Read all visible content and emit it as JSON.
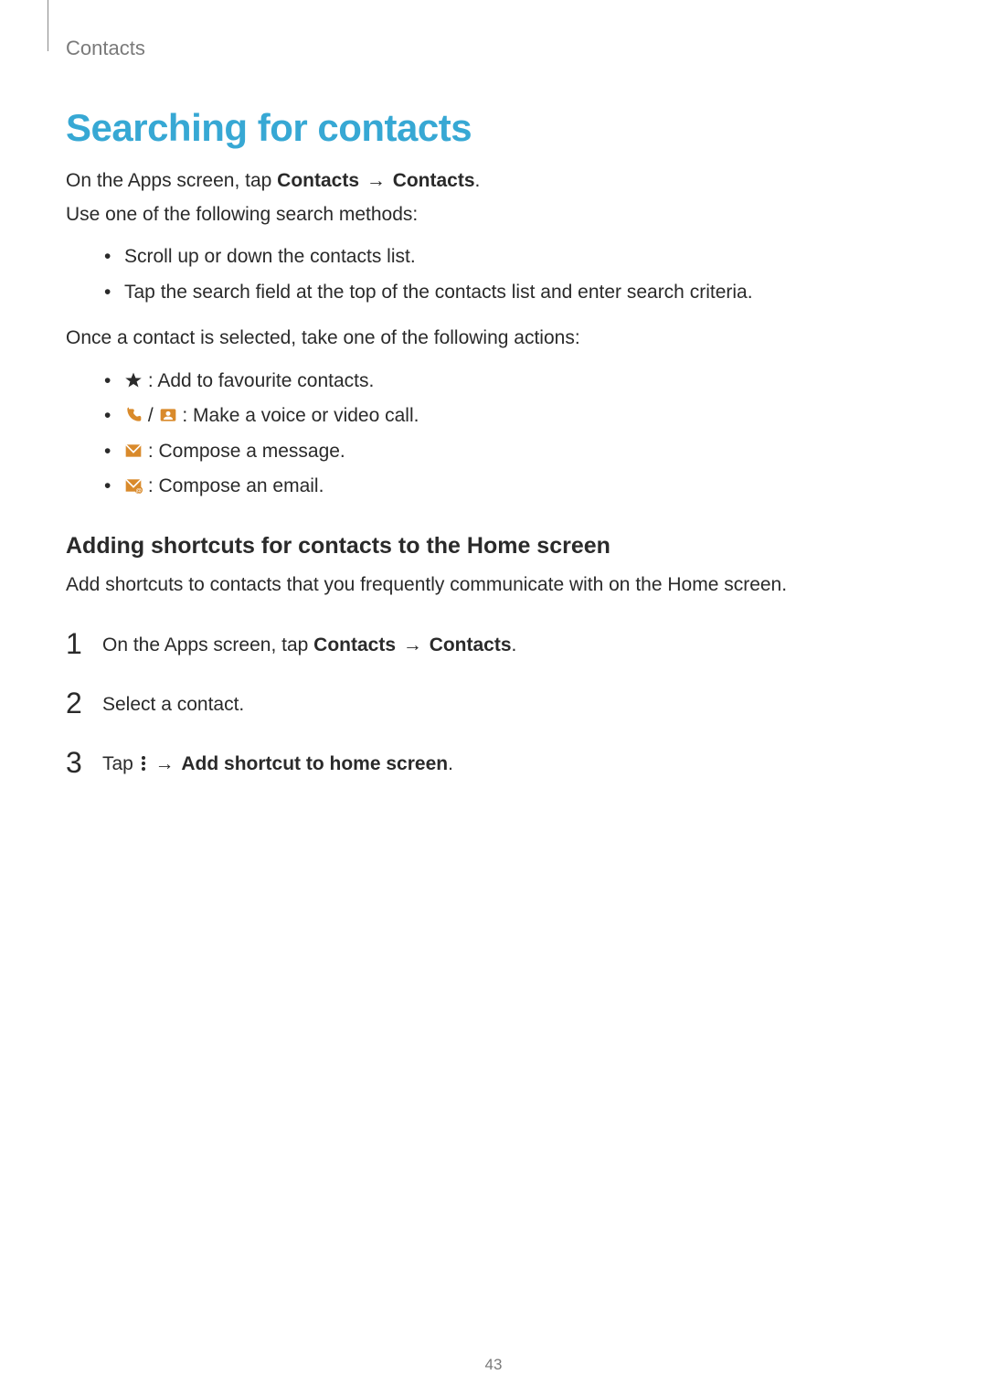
{
  "breadcrumb": "Contacts",
  "title": "Searching for contacts",
  "intro": {
    "line1_pre": "On the Apps screen, tap ",
    "line1_b1": "Contacts",
    "line1_arrow": " → ",
    "line1_b2": "Contacts",
    "line1_post": ".",
    "line2": "Use one of the following search methods:"
  },
  "search_methods": [
    "Scroll up or down the contacts list.",
    "Tap the search field at the top of the contacts list and enter search criteria."
  ],
  "mid_text": "Once a contact is selected, take one of the following actions:",
  "actions": {
    "fav": " : Add to favourite contacts.",
    "call_sep": " / ",
    "call_text": " : Make a voice or video call.",
    "msg": " : Compose a message.",
    "email": " : Compose an email."
  },
  "subheading": "Adding shortcuts for contacts to the Home screen",
  "sub_desc": "Add shortcuts to contacts that you frequently communicate with on the Home screen.",
  "steps": {
    "s1_pre": "On the Apps screen, tap ",
    "s1_b1": "Contacts",
    "s1_arrow": " → ",
    "s1_b2": "Contacts",
    "s1_post": ".",
    "s2": "Select a contact.",
    "s3_pre": "Tap ",
    "s3_arrow": " → ",
    "s3_bold": "Add shortcut to home screen",
    "s3_post": "."
  },
  "page_number": "43"
}
